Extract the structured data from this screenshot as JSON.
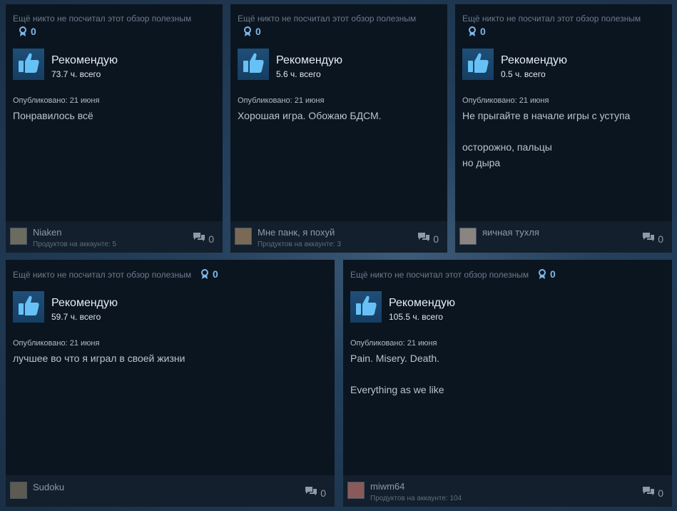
{
  "colors": {
    "card_bg": "#0b1520",
    "footer_bg": "#131f2c",
    "accent_blue": "#7fb6e8",
    "thumb_bg": "#1e4e78"
  },
  "reviews": [
    {
      "helpful_text": "Ещё никто не посчитал этот обзор полезным",
      "award_icon": "award-ribbon-icon",
      "award_count": "0",
      "thumb_icon": "thumbs-up-icon",
      "recommendation": "Рекомендую",
      "hours": "73.7 ч. всего",
      "posted": "Опубликовано: 21 июня",
      "text_lines": [
        "Понравилось всё"
      ],
      "author": "Niaken",
      "products": "Продуктов на аккаунте: 5",
      "comment_icon": "comment-bubbles-icon",
      "comments": "0",
      "avatar_color": "#6b6b5f"
    },
    {
      "helpful_text": "Ещё никто не посчитал этот обзор полезным",
      "award_icon": "award-ribbon-icon",
      "award_count": "0",
      "thumb_icon": "thumbs-up-icon",
      "recommendation": "Рекомендую",
      "hours": "5.6 ч. всего",
      "posted": "Опубликовано: 21 июня",
      "text_lines": [
        "Хорошая игра. Обожаю БДСМ."
      ],
      "author": "Мне панк, я похуй",
      "products": "Продуктов на аккаунте: 3",
      "comment_icon": "comment-bubbles-icon",
      "comments": "0",
      "avatar_color": "#7a6a55"
    },
    {
      "helpful_text": "Ещё никто не посчитал этот обзор полезным",
      "award_icon": "award-ribbon-icon",
      "award_count": "0",
      "thumb_icon": "thumbs-up-icon",
      "recommendation": "Рекомендую",
      "hours": "0.5 ч. всего",
      "posted": "Опубликовано: 21 июня",
      "text_lines": [
        "Не прыгайте в начале игры с уступа",
        "",
        "осторожно, пальцы",
        "но дыра"
      ],
      "author": "яичная тухля",
      "products": "",
      "comment_icon": "comment-bubbles-icon",
      "comments": "0",
      "avatar_color": "#8a8580"
    },
    {
      "helpful_text": "Ещё никто не посчитал этот обзор полезным",
      "award_icon": "award-ribbon-icon",
      "award_count": "0",
      "thumb_icon": "thumbs-up-icon",
      "recommendation": "Рекомендую",
      "hours": "59.7 ч. всего",
      "posted": "Опубликовано: 21 июня",
      "text_lines": [
        "лучшее во что я играл в своей жизни"
      ],
      "author": "Sudoku",
      "products": "",
      "comment_icon": "comment-bubbles-icon",
      "comments": "0",
      "avatar_color": "#5d5a52"
    },
    {
      "helpful_text": "Ещё никто не посчитал этот обзор полезным",
      "award_icon": "award-ribbon-icon",
      "award_count": "0",
      "thumb_icon": "thumbs-up-icon",
      "recommendation": "Рекомендую",
      "hours": "105.5 ч. всего",
      "posted": "Опубликовано: 21 июня",
      "text_lines": [
        "Pain. Misery. Death.",
        "",
        "Everything as we like"
      ],
      "author": "miwm64",
      "products": "Продуктов на аккаунте: 104",
      "comment_icon": "comment-bubbles-icon",
      "comments": "0",
      "avatar_color": "#8a5a5a"
    }
  ]
}
